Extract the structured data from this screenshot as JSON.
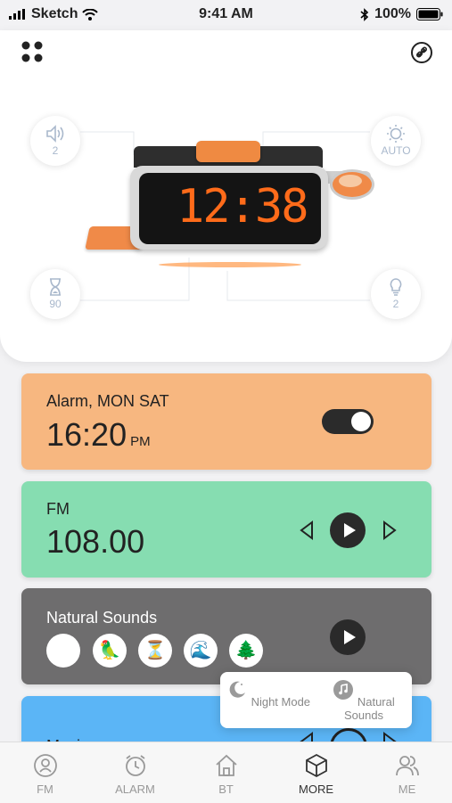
{
  "status": {
    "carrier": "Sketch",
    "time": "9:41 AM",
    "battery": "100%"
  },
  "header": {
    "menu_icon": "grid-icon",
    "link_icon": "link-icon"
  },
  "hero": {
    "volume": {
      "icon": "speaker-icon",
      "value": "2"
    },
    "auto": {
      "icon": "sun-icon",
      "value": "AUTO"
    },
    "timer": {
      "icon": "hourglass-icon",
      "value": "90"
    },
    "light": {
      "icon": "bulb-icon",
      "value": "2"
    },
    "clock_display": "12:38"
  },
  "alarm": {
    "label": "Alarm, MON SAT",
    "time": "16:20",
    "period": "PM",
    "enabled": true,
    "color": "#f7b780"
  },
  "fm": {
    "label": "FM",
    "frequency": "108.00",
    "color": "#86ddb1"
  },
  "natural_sounds": {
    "label": "Natural Sounds",
    "color": "#6e6d6e",
    "icons": [
      "rain-icon",
      "bird-icon",
      "hourglass-icon",
      "wave-icon",
      "forest-icon"
    ]
  },
  "music": {
    "label": "Music",
    "color": "#5bb5f6"
  },
  "popup": {
    "night_mode": "Night Mode",
    "natural_sounds": "Natural Sounds"
  },
  "tabbar": [
    {
      "label": "FM",
      "icon": "radio-icon"
    },
    {
      "label": "ALARM",
      "icon": "alarm-clock-icon"
    },
    {
      "label": "BT",
      "icon": "home-icon"
    },
    {
      "label": "MORE",
      "icon": "cube-icon"
    },
    {
      "label": "ME",
      "icon": "people-icon"
    }
  ]
}
